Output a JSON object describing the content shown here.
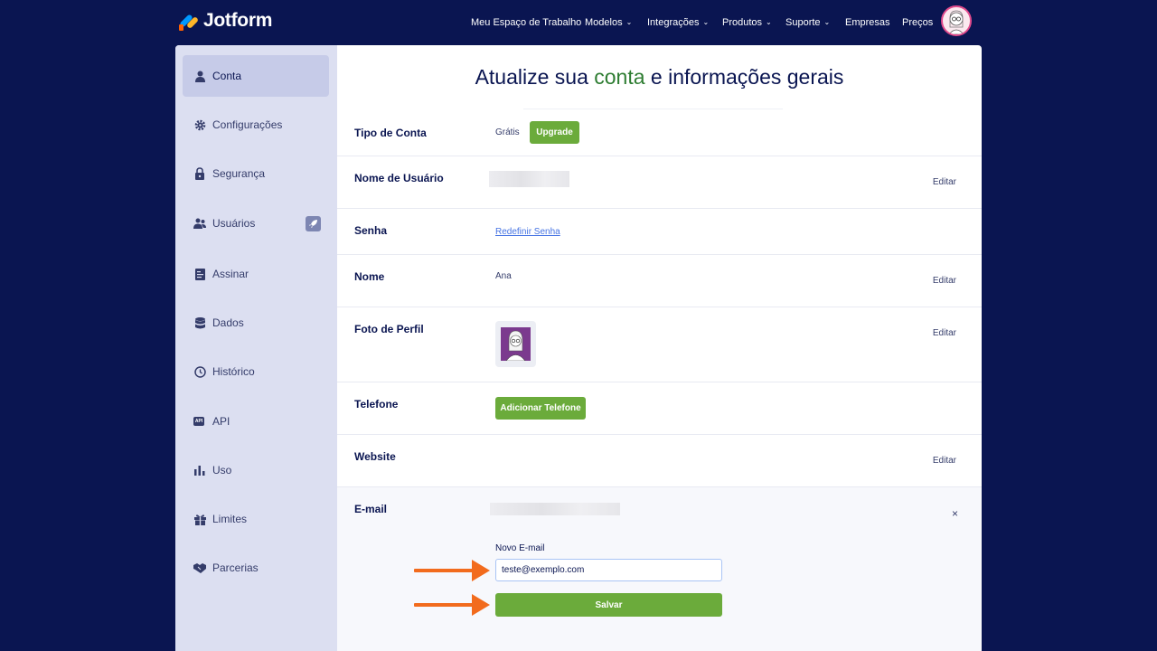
{
  "brand": {
    "name": "Jotform"
  },
  "nav": {
    "items": [
      {
        "label": "Meu Espaço de Trabalho",
        "dropdown": false
      },
      {
        "label": "Modelos",
        "dropdown": true
      },
      {
        "label": "Integrações",
        "dropdown": true
      },
      {
        "label": "Produtos",
        "dropdown": true
      },
      {
        "label": "Suporte",
        "dropdown": true
      },
      {
        "label": "Empresas",
        "dropdown": false
      },
      {
        "label": "Preços",
        "dropdown": false
      }
    ],
    "chevron": "⌄"
  },
  "sidebar": {
    "items": [
      {
        "label": "Conta",
        "icon": "user-icon",
        "active": true
      },
      {
        "label": "Configurações",
        "icon": "gear-icon"
      },
      {
        "label": "Segurança",
        "icon": "lock-icon"
      },
      {
        "label": "Usuários",
        "icon": "users-icon"
      },
      {
        "label": "Assinar",
        "icon": "sign-document-icon"
      },
      {
        "label": "Dados",
        "icon": "database-icon"
      },
      {
        "label": "Histórico",
        "icon": "history-icon"
      },
      {
        "label": "API",
        "icon": "api-icon",
        "glyph": "API"
      },
      {
        "label": "Uso",
        "icon": "bar-chart-icon"
      },
      {
        "label": "Limites",
        "icon": "gift-icon"
      },
      {
        "label": "Parcerias",
        "icon": "handshake-icon"
      }
    ]
  },
  "page": {
    "title_before": "Atualize sua ",
    "title_accent": "conta",
    "title_after": " e informações gerais"
  },
  "account": {
    "account_type": {
      "label": "Tipo de Conta",
      "value": "Grátis",
      "upgrade_button": "Upgrade"
    },
    "username": {
      "label": "Nome de Usuário",
      "edit": "Editar"
    },
    "password": {
      "label": "Senha",
      "reset_link": "Redefinir Senha"
    },
    "name": {
      "label": "Nome",
      "value": "Ana",
      "edit": "Editar"
    },
    "photo": {
      "label": "Foto de Perfil",
      "edit": "Editar"
    },
    "phone": {
      "label": "Telefone",
      "add_button": "Adicionar Telefone"
    },
    "website": {
      "label": "Website",
      "edit": "Editar"
    },
    "email": {
      "label": "E-mail",
      "close": "×",
      "new_email_label": "Novo E-mail",
      "new_email_value": "teste@exemplo.com",
      "save_button": "Salvar"
    }
  },
  "colors": {
    "navy": "#0a1551",
    "sidebar_bg": "#dcdff1",
    "green": "#6bab3b",
    "accent_green": "#2e7d32",
    "arrow_orange": "#f26b1d"
  }
}
